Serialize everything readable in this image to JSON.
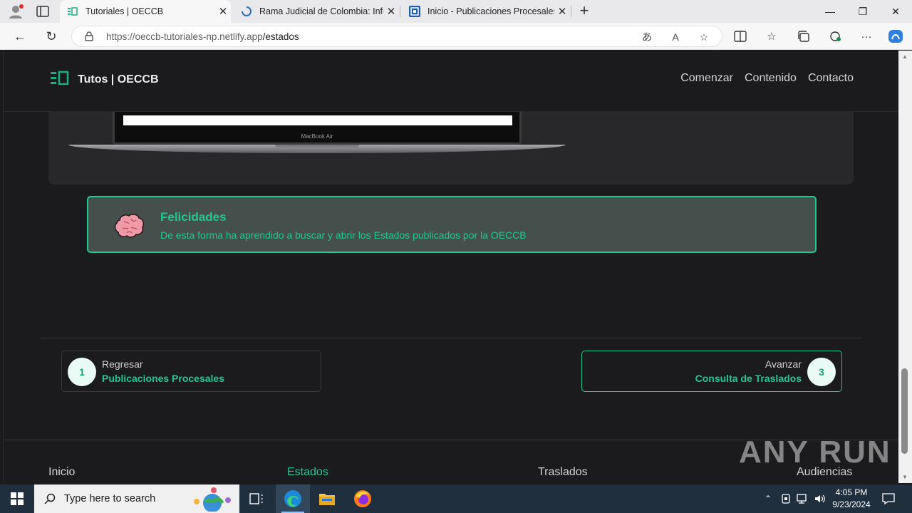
{
  "browser": {
    "tabs": [
      {
        "title": "Tutoriales | OECCB",
        "active": true
      },
      {
        "title": "Rama Judicial de Colombia: Infor",
        "active": false
      },
      {
        "title": "Inicio - Publicaciones Procesales",
        "active": false
      }
    ],
    "url_host": "https://oeccb-tutoriales-np.netlify.app",
    "url_path": "/estados"
  },
  "site": {
    "brand": "Tutos | OECCB",
    "nav": [
      "Comenzar",
      "Contenido",
      "Contacto"
    ],
    "laptop_label": "MacBook Air",
    "congrats": {
      "title": "Felicidades",
      "text": "De esta forma ha aprendido a buscar y abrir los Estados publicados por la OECCB"
    },
    "prev": {
      "label": "Regresar",
      "title": "Publicaciones Procesales",
      "number": "1"
    },
    "next": {
      "label": "Avanzar",
      "title": "Consulta de Traslados",
      "number": "3"
    },
    "footer": [
      "Inicio",
      "Estados",
      "Traslados",
      "Audiencias"
    ]
  },
  "watermark": "ANY RUN",
  "taskbar": {
    "search_placeholder": "Type here to search",
    "time": "4:05 PM",
    "date": "9/23/2024"
  },
  "colors": {
    "accent": "#22c78f",
    "page_bg": "#1b1b1d",
    "card_bg": "#28282b"
  }
}
